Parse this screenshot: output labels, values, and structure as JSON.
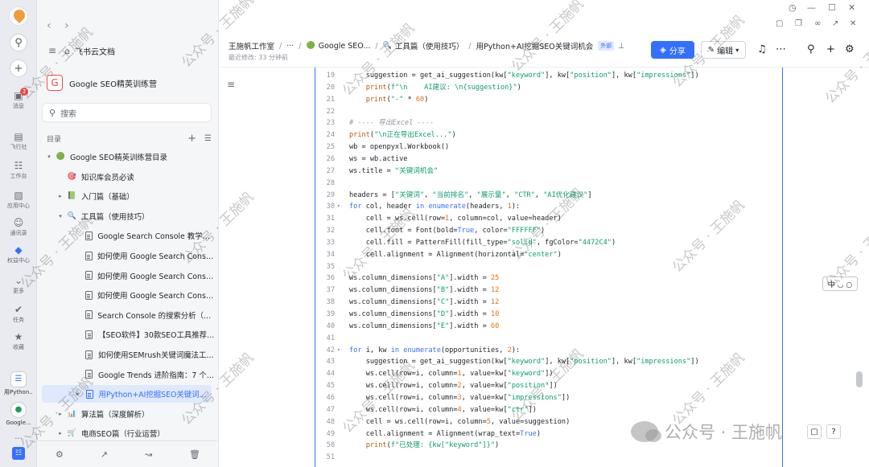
{
  "rail": {
    "badge": "2",
    "items": [
      {
        "label": "消息",
        "icon": "chat-icon"
      },
      {
        "label": "飞行社",
        "icon": "feixing-icon"
      },
      {
        "label": "工作台",
        "icon": "grid-icon"
      },
      {
        "label": "应用中心",
        "icon": "app-center-icon"
      },
      {
        "label": "通讯录",
        "icon": "contacts-icon"
      },
      {
        "label": "权益中心",
        "icon": "diamond-icon"
      },
      {
        "label": "更多",
        "icon": "chevron-down-icon"
      },
      {
        "label": "任务",
        "icon": "check-icon"
      },
      {
        "label": "收藏",
        "icon": "star-icon"
      }
    ],
    "apps": [
      {
        "label": "用Python...",
        "icon": "doc-icon"
      },
      {
        "label": "Google...",
        "icon": "google-icon"
      }
    ],
    "more": "..."
  },
  "sidebar": {
    "brand": "飞书云文档",
    "space_icon": "G",
    "space_name": "Google SEO精英训练营",
    "search_placeholder": "搜索",
    "toc_label": "目录",
    "tree": [
      {
        "label": "Google SEO精英训练营目录",
        "level": 0,
        "arrow": "▾",
        "icon": "🟢"
      },
      {
        "label": "知识库会员必读",
        "level": 1,
        "arrow": "",
        "icon": "🎯"
      },
      {
        "label": "入门篇（基础）",
        "level": 1,
        "arrow": "▸",
        "icon": "📗"
      },
      {
        "label": "工具篇（使用技巧）",
        "level": 1,
        "arrow": "▾",
        "icon": "🔍"
      },
      {
        "label": "Google Search Console 教学：使...",
        "level": 2,
        "arrow": "",
        "icon": "doc"
      },
      {
        "label": "如何使用 Google Search Console ...",
        "level": 2,
        "arrow": "",
        "icon": "doc"
      },
      {
        "label": "如何使用 Google Search Console ...",
        "level": 2,
        "arrow": "",
        "icon": "doc"
      },
      {
        "label": "如何使用 Google Search Console ...",
        "level": 2,
        "arrow": "",
        "icon": "doc"
      },
      {
        "label": "Search Console 的搜索分析（成效...",
        "level": 2,
        "arrow": "",
        "icon": "doc"
      },
      {
        "label": "【SEO软件】30款SEO工具推荐+...",
        "level": 2,
        "arrow": "",
        "icon": "doc"
      },
      {
        "label": "如何使用SEMrush关键词魔法工具...",
        "level": 2,
        "arrow": "",
        "icon": "doc"
      },
      {
        "label": "Google Trends 进阶指南：7 个技...",
        "level": 2,
        "arrow": "",
        "icon": "doc"
      },
      {
        "label": "用Python+AI挖掘SEO关键词机会",
        "level": 2,
        "arrow": "▸",
        "icon": "doc",
        "active": true
      },
      {
        "label": "算法篇（深度解析）",
        "level": 1,
        "arrow": "▸",
        "icon": "📊"
      },
      {
        "label": "电商SEO篇（行业运营）",
        "level": 1,
        "arrow": "▸",
        "icon": "🛒"
      }
    ]
  },
  "header": {
    "crumbs": [
      "王施帆工作室",
      "···",
      "Google SEO...",
      "工具篇（使用技巧）",
      "用Python+AI挖掘SEO关键词机会"
    ],
    "external_tag": "外部",
    "modified": "最近修改: 33 分钟前",
    "share": "分享",
    "edit": "编辑"
  },
  "code": {
    "lines": [
      {
        "n": "19",
        "fold": "",
        "html": "    suggestion = get_ai_suggestion(kw[<span class=\"s\">\"keyword\"</span>], kw[<span class=\"s\">\"position\"</span>], kw[<span class=\"s\">\"impressions\"</span>])"
      },
      {
        "n": "20",
        "fold": "",
        "html": "    <span class=\"f\">print</span>(<span class=\"s\">f\"\\n    AI建议: \\n{suggestion}\"</span>)"
      },
      {
        "n": "21",
        "fold": "",
        "html": "    <span class=\"f\">print</span>(<span class=\"s\">\"-\"</span> * <span class=\"n\">60</span>)"
      },
      {
        "n": "22",
        "fold": "",
        "html": ""
      },
      {
        "n": "23",
        "fold": "",
        "html": "<span class=\"c\"># ---- 导出Excel ----</span>"
      },
      {
        "n": "24",
        "fold": "",
        "html": "<span class=\"f\">print</span>(<span class=\"s\">\"\\n正在导出Excel...\"</span>)"
      },
      {
        "n": "25",
        "fold": "",
        "html": "wb = openpyxl.Workbook()"
      },
      {
        "n": "26",
        "fold": "",
        "html": "ws = wb.active"
      },
      {
        "n": "27",
        "fold": "",
        "html": "ws.title = <span class=\"s\">\"关键词机会\"</span>"
      },
      {
        "n": "28",
        "fold": "",
        "html": ""
      },
      {
        "n": "29",
        "fold": "",
        "html": "headers = [<span class=\"s\">\"关键词\"</span>, <span class=\"s\">\"当前排名\"</span>, <span class=\"s\">\"展示量\"</span>, <span class=\"s\">\"CTR\"</span>, <span class=\"s\">\"AI优化建议\"</span>]"
      },
      {
        "n": "30",
        "fold": "▾",
        "html": "<span class=\"k\">for</span> col, header <span class=\"k\">in</span> <span class=\"k\">enumerate</span>(headers, <span class=\"n\">1</span>):"
      },
      {
        "n": "31",
        "fold": "",
        "html": "    cell = ws.cell(row=<span class=\"n\">1</span>, column=col, value=header)"
      },
      {
        "n": "32",
        "fold": "",
        "html": "    cell.font = Font(bold=<span class=\"k\">True</span>, color=<span class=\"s\">\"FFFFFF\"</span>)"
      },
      {
        "n": "33",
        "fold": "",
        "html": "    cell.fill = PatternFill(fill_type=<span class=\"s\">\"solid\"</span>, fgColor=<span class=\"s\">\"4472C4\"</span>)"
      },
      {
        "n": "34",
        "fold": "",
        "html": "    cell.alignment = Alignment(horizontal=<span class=\"s\">\"center\"</span>)"
      },
      {
        "n": "35",
        "fold": "",
        "html": ""
      },
      {
        "n": "36",
        "fold": "",
        "html": "ws.column_dimensions[<span class=\"s\">\"A\"</span>].width = <span class=\"n\">25</span>"
      },
      {
        "n": "37",
        "fold": "",
        "html": "ws.column_dimensions[<span class=\"s\">\"B\"</span>].width = <span class=\"n\">12</span>"
      },
      {
        "n": "38",
        "fold": "",
        "html": "ws.column_dimensions[<span class=\"s\">\"C\"</span>].width = <span class=\"n\">12</span>"
      },
      {
        "n": "39",
        "fold": "",
        "html": "ws.column_dimensions[<span class=\"s\">\"D\"</span>].width = <span class=\"n\">10</span>"
      },
      {
        "n": "40",
        "fold": "",
        "html": "ws.column_dimensions[<span class=\"s\">\"E\"</span>].width = <span class=\"n\">60</span>"
      },
      {
        "n": "41",
        "fold": "",
        "html": ""
      },
      {
        "n": "42",
        "fold": "▾",
        "html": "<span class=\"k\">for</span> i, kw <span class=\"k\">in</span> <span class=\"k\">enumerate</span>(opportunities, <span class=\"n\">2</span>):"
      },
      {
        "n": "43",
        "fold": "",
        "html": "    suggestion = get_ai_suggestion(kw[<span class=\"s\">\"keyword\"</span>], kw[<span class=\"s\">\"position\"</span>], kw[<span class=\"s\">\"impressions\"</span>])"
      },
      {
        "n": "44",
        "fold": "",
        "html": "    ws.cell(row=i, column=<span class=\"n\">1</span>, value=kw[<span class=\"s\">\"keyword\"</span>])"
      },
      {
        "n": "45",
        "fold": "",
        "html": "    ws.cell(row=i, column=<span class=\"n\">2</span>, value=kw[<span class=\"s\">\"position\"</span>])"
      },
      {
        "n": "46",
        "fold": "",
        "html": "    ws.cell(row=i, column=<span class=\"n\">3</span>, value=kw[<span class=\"s\">\"impressions\"</span>])"
      },
      {
        "n": "47",
        "fold": "",
        "html": "    ws.cell(row=i, column=<span class=\"n\">4</span>, value=kw[<span class=\"s\">\"ctr\"</span>])"
      },
      {
        "n": "48",
        "fold": "",
        "html": "    cell = ws.cell(row=i, column=<span class=\"n\">5</span>, value=suggestion)"
      },
      {
        "n": "49",
        "fold": "",
        "html": "    cell.alignment = Alignment(wrap_text=<span class=\"k\">True</span>)"
      },
      {
        "n": "50",
        "fold": "",
        "html": "    <span class=\"f\">print</span>(<span class=\"s\">f\"已处理: {kw[\"keyword\"]}\"</span>)"
      },
      {
        "n": "51",
        "fold": "",
        "html": ""
      }
    ]
  },
  "ime": "中 ◡ ○",
  "watermark_text": "公众号 · 王施帆",
  "wechat_label": "公众号 · 王施帆",
  "colors": {
    "accent": "#3370ff",
    "string": "#0a9d6e",
    "number": "#e37318"
  }
}
